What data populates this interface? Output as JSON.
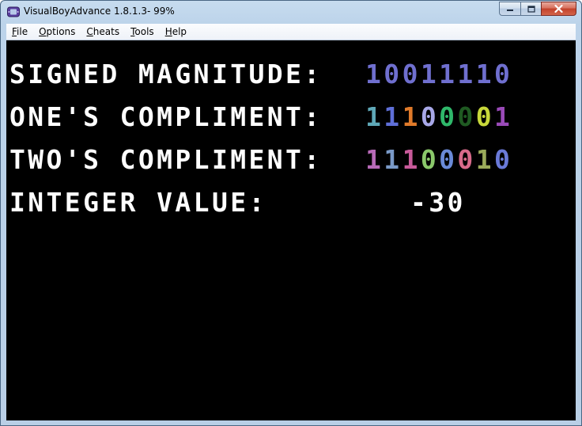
{
  "window": {
    "title": "VisualBoyAdvance 1.8.1.3- 99%"
  },
  "caption_buttons": {
    "minimize_icon": "minimize-icon",
    "maximize_icon": "maximize-icon",
    "close_icon": "close-icon"
  },
  "menu": {
    "items": [
      {
        "label": "File",
        "accelerator": "F",
        "rest": "ile"
      },
      {
        "label": "Options",
        "accelerator": "O",
        "rest": "ptions"
      },
      {
        "label": "Cheats",
        "accelerator": "C",
        "rest": "heats"
      },
      {
        "label": "Tools",
        "accelerator": "T",
        "rest": "ools"
      },
      {
        "label": "Help",
        "accelerator": "H",
        "rest": "elp"
      }
    ]
  },
  "game_screen": {
    "rows": [
      {
        "label": "SIGNED MAGNITUDE:",
        "value": "10011110",
        "digit_colors": [
          "#6f6fcf",
          "#6f6fcf",
          "#6f6fcf",
          "#6f6fcf",
          "#6f6fcf",
          "#6f6fcf",
          "#6f6fcf",
          "#6f6fcf"
        ]
      },
      {
        "label": "ONE'S COMPLIMENT:",
        "value": "11100001",
        "digit_colors": [
          "#5fa8b8",
          "#5f6fd8",
          "#e07a2a",
          "#a8a8e8",
          "#2fb86a",
          "#1f5a22",
          "#c8d83a",
          "#9a4ab8"
        ]
      },
      {
        "label": "TWO'S COMPLIMENT:",
        "value": "11100010",
        "digit_colors": [
          "#b86ab8",
          "#7a9ac8",
          "#c85a9a",
          "#8ac86a",
          "#6a8ad8",
          "#d86a8a",
          "#9aaa5a",
          "#6a7ad8"
        ]
      }
    ],
    "integer": {
      "label": "INTEGER VALUE:",
      "value": "-30"
    }
  }
}
